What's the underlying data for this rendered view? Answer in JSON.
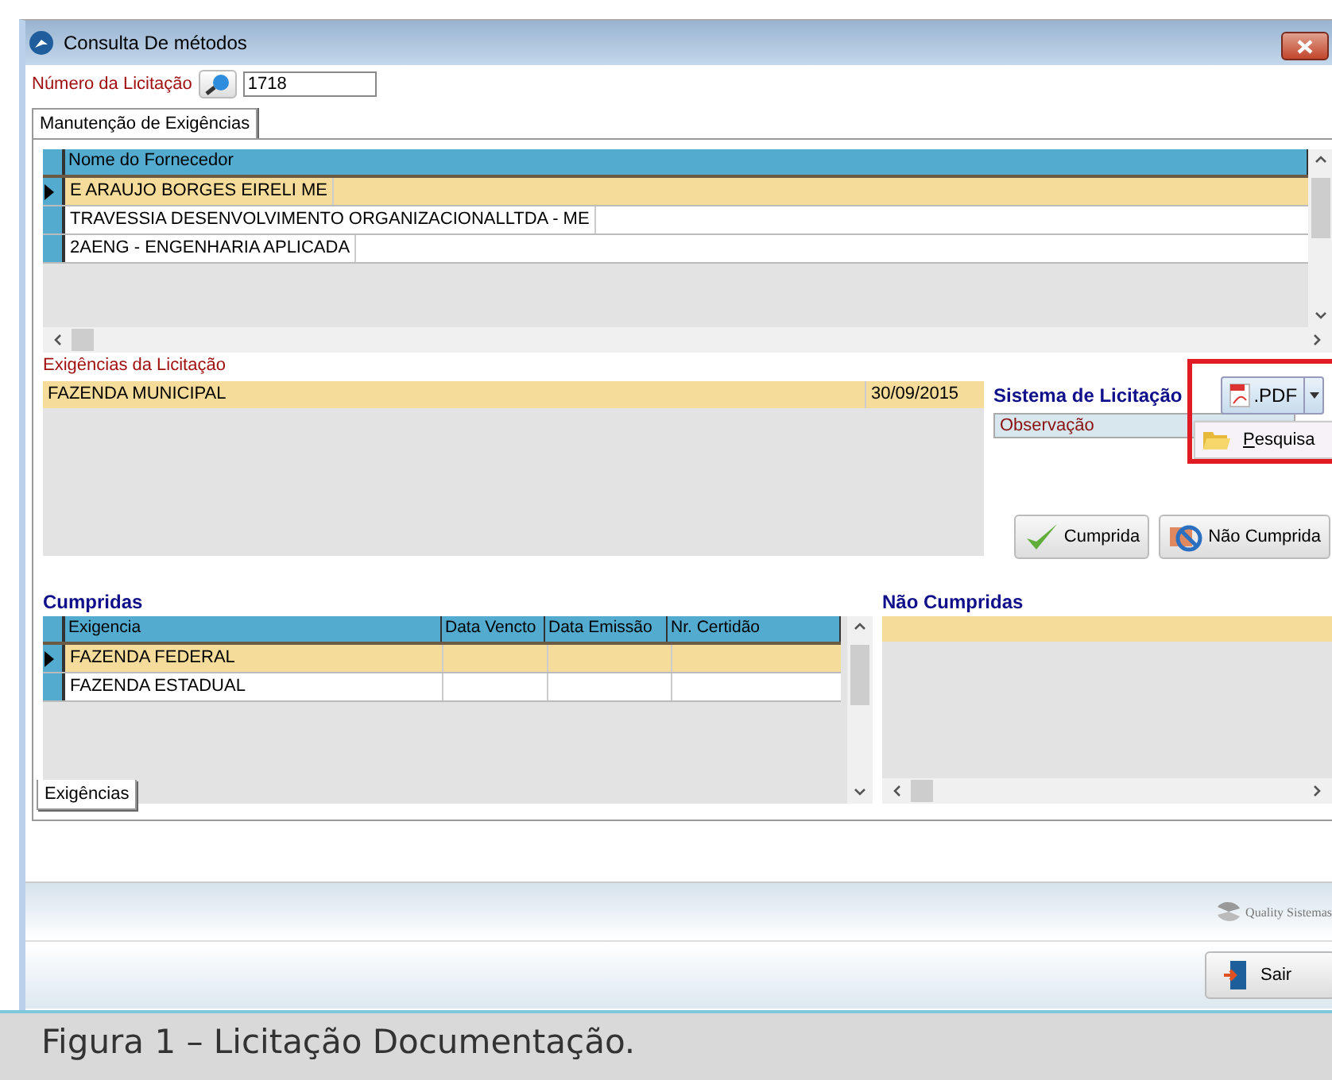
{
  "window": {
    "title": "Consulta De métodos"
  },
  "licitacao": {
    "label": "Número da Licitação",
    "value": "1718"
  },
  "tabs": [
    {
      "label": "Manutenção de Exigências",
      "selected": true
    }
  ],
  "fornecedores": {
    "columns": [
      "Nome do Fornecedor"
    ],
    "rows": [
      {
        "name": "E ARAUJO BORGES EIRELI ME",
        "selected": true
      },
      {
        "name": "TRAVESSIA DESENVOLVIMENTO ORGANIZACIONALLTDA - ME",
        "selected": false
      },
      {
        "name": "2AENG - ENGENHARIA APLICADA",
        "selected": false
      }
    ]
  },
  "exigencias": {
    "label": "Exigências da Licitação",
    "rows": [
      {
        "name": "FAZENDA MUNICIPAL",
        "date": "30/09/2015",
        "selected": true
      }
    ]
  },
  "sistema": {
    "label": "Sistema de Licitação",
    "pdf_button": ".PDF",
    "menu": [
      {
        "label": "Pesquisa"
      }
    ],
    "observacao_label": "Observação"
  },
  "actions": [
    {
      "label": "Cumprida",
      "kind": "check"
    },
    {
      "label": "Não Cumprida",
      "kind": "cross"
    }
  ],
  "cumpridas": {
    "label": "Cumpridas",
    "columns": [
      "Exigencia",
      "Data Vencto",
      "Data Emissão",
      "Nr. Certidão"
    ],
    "rows": [
      {
        "exigencia": "FAZENDA FEDERAL",
        "selected": true
      },
      {
        "exigencia": "FAZENDA ESTADUAL",
        "selected": false
      }
    ]
  },
  "nao_cumpridas": {
    "label": "Não Cumpridas"
  },
  "bottom_tabs": [
    {
      "label": "Exigências",
      "selected": true
    }
  ],
  "footer": {
    "logo_text": "Quality Sistemas"
  },
  "exit_button": "Sair",
  "caption": "Figura 1 – Licitação Documentação."
}
